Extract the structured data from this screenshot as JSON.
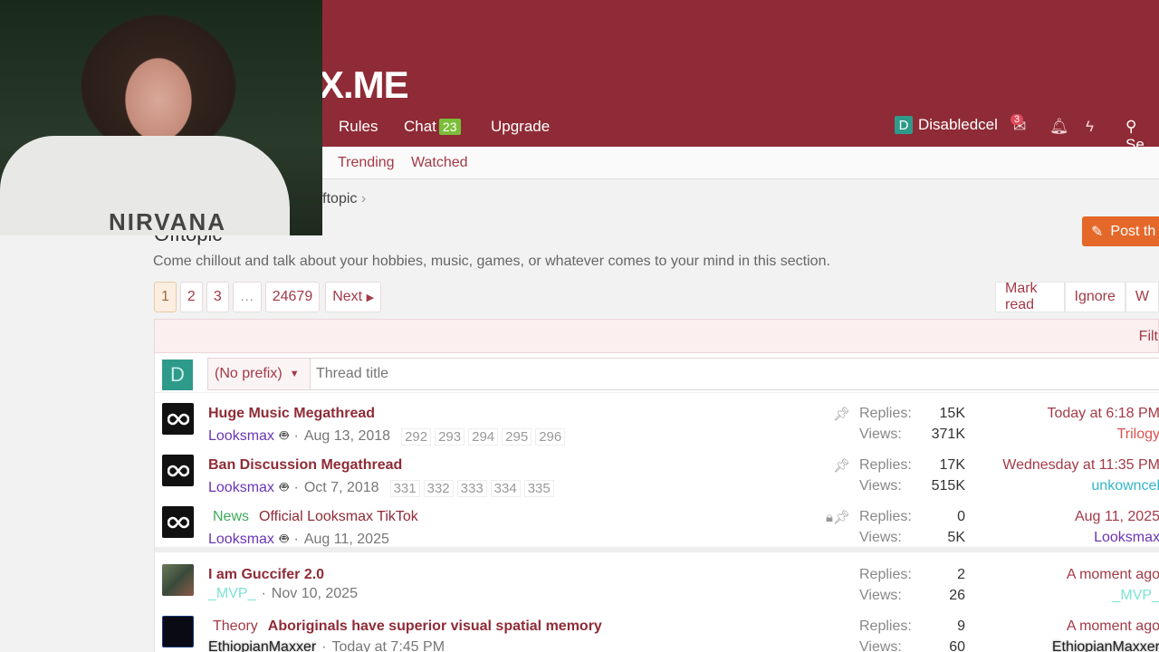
{
  "header": {
    "logo_text": "X.ME",
    "nav": [
      {
        "label": "Rules"
      },
      {
        "label": "Chat",
        "badge": "23"
      },
      {
        "label": "Upgrade"
      }
    ],
    "user": {
      "initial": "D",
      "name": "Disabledcel"
    },
    "mail_count": "3",
    "search_label": "Se"
  },
  "subnav": {
    "links": [
      "Trending",
      "Watched"
    ]
  },
  "breadcrumb": "fftopic",
  "page": {
    "title": "Offtopic",
    "description": "Come chillout and talk about your hobbies, music, games, or whatever comes to your mind in this section.",
    "post_button": "Post th"
  },
  "pagination": {
    "pages": [
      "1",
      "2",
      "3",
      "…",
      "24679"
    ],
    "next": "Next"
  },
  "actions": [
    "Mark read",
    "Ignore",
    "W"
  ],
  "filter_label": "Filt",
  "quick_thread": {
    "avatar_initial": "D",
    "prefix": "(No prefix)",
    "placeholder": "Thread title"
  },
  "threads": [
    {
      "title": "Huge Music Megathread",
      "author": "Looksmax",
      "date": "Aug 13, 2018",
      "pages": [
        "292",
        "293",
        "294",
        "295",
        "296"
      ],
      "replies": "15K",
      "views": "371K",
      "last_date": "Today at 6:18 PM",
      "last_user": "Trilogy"
    },
    {
      "title": "Ban Discussion Megathread",
      "author": "Looksmax",
      "date": "Oct 7, 2018",
      "pages": [
        "331",
        "332",
        "333",
        "334",
        "335"
      ],
      "replies": "17K",
      "views": "515K",
      "last_date": "Wednesday at 11:35 PM",
      "last_user": "unkowncel"
    },
    {
      "prefix": "News",
      "title": "Official Looksmax TikTok",
      "author": "Looksmax",
      "date": "Aug 11, 2025",
      "replies": "0",
      "views": "5K",
      "last_date": "Aug 11, 2025",
      "last_user": "Looksmax"
    },
    {
      "title": "I am Guccifer 2.0",
      "author": "_MVP_",
      "date": "Nov 10, 2025",
      "replies": "2",
      "views": "26",
      "last_date": "A moment ago",
      "last_user": "_MVP_"
    },
    {
      "prefix": "Theory",
      "title": "Aboriginals have superior visual spatial memory",
      "author": "EthiopianMaxxer",
      "date": "Today at 7:45 PM",
      "replies": "9",
      "views": "60",
      "last_date": "A moment ago",
      "last_user": "EthiopianMaxxer"
    }
  ],
  "labels": {
    "replies": "Replies:",
    "views": "Views:"
  },
  "webcam": {
    "shirt_text": "NIRVANA"
  }
}
